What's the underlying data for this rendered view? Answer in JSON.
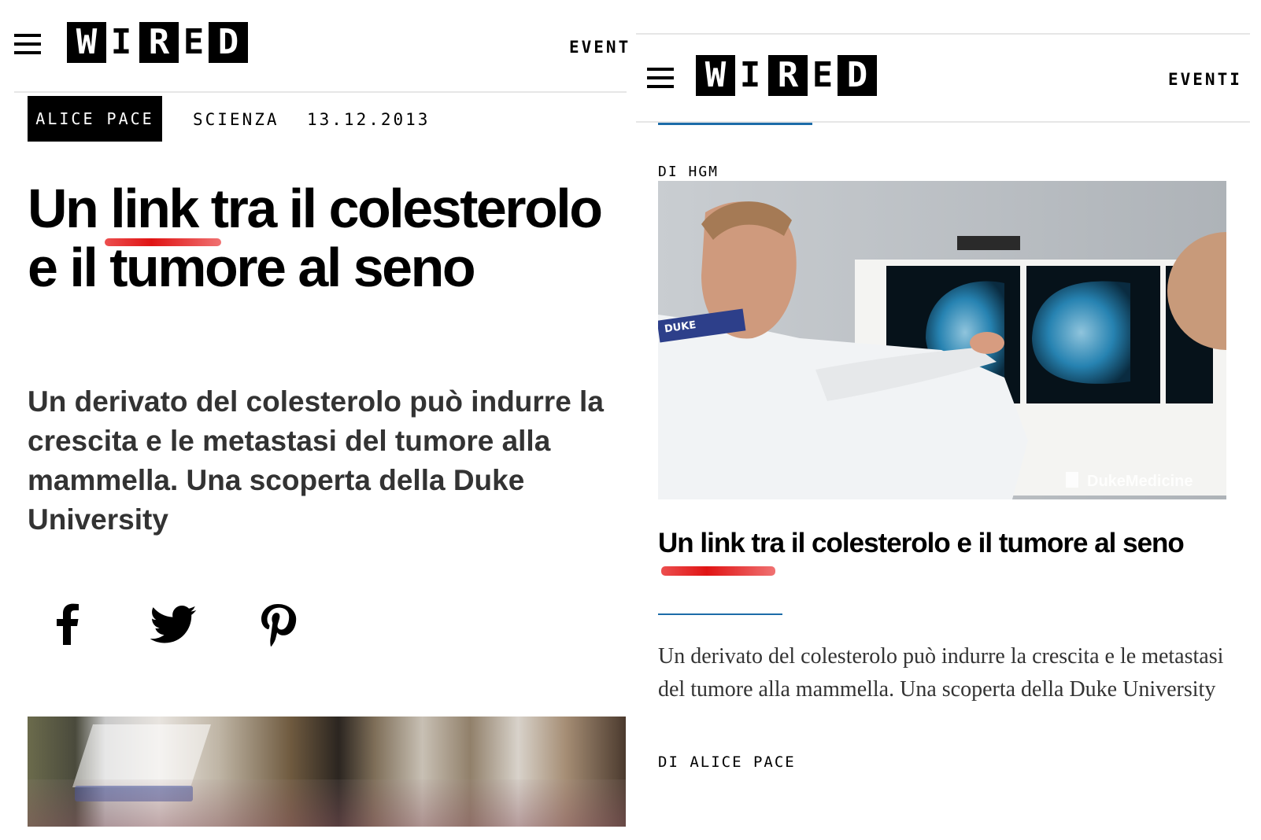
{
  "brand": {
    "letters": [
      "W",
      "I",
      "R",
      "E",
      "D"
    ]
  },
  "left_panel": {
    "header": {
      "nav_label": "EVENT"
    },
    "meta": {
      "author": "ALICE PACE",
      "section": "SCIENZA",
      "date": "13.12.2013"
    },
    "headline": "Un link tra il colesterolo e il tumore al seno",
    "subhead": "Un derivato del colesterolo può indurre la crescita e le metastasi del tumore alla mammella. Una scoperta della Duke University",
    "social": {
      "facebook": "f-icon",
      "twitter": "bird-icon",
      "pinterest": "p-icon"
    },
    "highlight_color": "#e01414"
  },
  "right_panel": {
    "header": {
      "nav_label": "EVENTI"
    },
    "byline_top": "DI HGM",
    "image": {
      "watermark": "DukeMedicine",
      "badge_text": "DUKE"
    },
    "headline": "Un link tra il colesterolo e il tumore al seno",
    "dek": "Un derivato del colesterolo può indurre la crescita e le metastasi del tumore alla mammella. Una scoperta della Duke University",
    "byline": "DI ALICE PACE",
    "accent_color": "#1c6ca9"
  }
}
